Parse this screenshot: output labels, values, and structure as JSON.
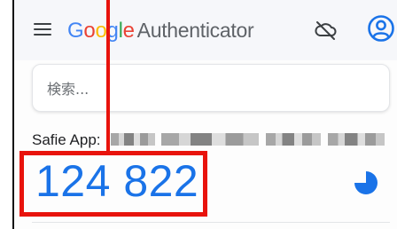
{
  "app": {
    "brand_word": "Google",
    "brand_letters": [
      "G",
      "o",
      "o",
      "g",
      "l",
      "e"
    ],
    "product_name": "Authenticator"
  },
  "icons": {
    "menu": "menu-icon",
    "sync": "cloud-off-icon",
    "account": "account-circle-icon",
    "timer": "countdown-timer-icon"
  },
  "colors": {
    "accent": "#1a73e8",
    "highlight": "#e8130c"
  },
  "search": {
    "placeholder": "検索..."
  },
  "accounts": [
    {
      "issuer": "Safie App:",
      "code": "124 822",
      "timer_remaining_fraction": 0.75
    }
  ]
}
